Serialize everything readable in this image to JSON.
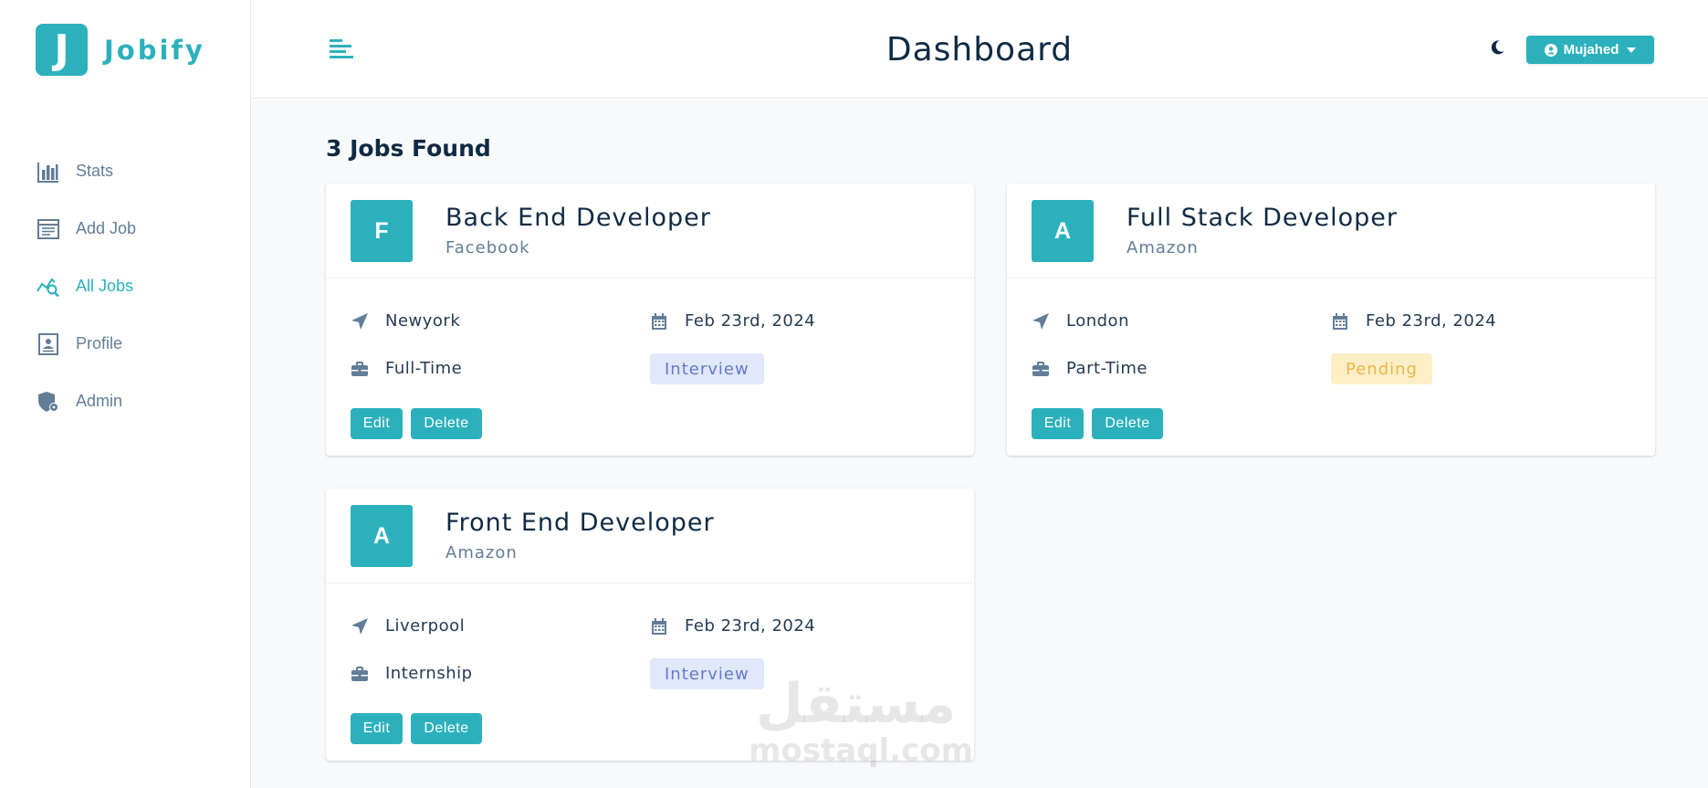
{
  "brand": {
    "logo_letter": "J",
    "name": "Jobify",
    "accent": "#2cb1bc"
  },
  "sidebar": {
    "items": [
      {
        "label": "Stats",
        "icon": "stats-chart-icon",
        "active": false
      },
      {
        "label": "Add Job",
        "icon": "add-job-form-icon",
        "active": false
      },
      {
        "label": "All Jobs",
        "icon": "all-jobs-search-icon",
        "active": true
      },
      {
        "label": "Profile",
        "icon": "profile-card-icon",
        "active": false
      },
      {
        "label": "Admin",
        "icon": "admin-shield-icon",
        "active": false
      }
    ]
  },
  "header": {
    "title": "Dashboard",
    "user_label": "Mujahed"
  },
  "main": {
    "jobs_found": "3 Jobs Found",
    "jobs": [
      {
        "avatar_letter": "F",
        "title": "Back End Developer",
        "company": "Facebook",
        "location": "Newyork",
        "date": "Feb 23rd, 2024",
        "type": "Full-Time",
        "status": "Interview",
        "status_kind": "interview",
        "edit_label": "Edit",
        "delete_label": "Delete"
      },
      {
        "avatar_letter": "A",
        "title": "Full Stack Developer",
        "company": "Amazon",
        "location": "London",
        "date": "Feb 23rd, 2024",
        "type": "Part-Time",
        "status": "Pending",
        "status_kind": "pending",
        "edit_label": "Edit",
        "delete_label": "Delete"
      },
      {
        "avatar_letter": "A",
        "title": "Front End Developer",
        "company": "Amazon",
        "location": "Liverpool",
        "date": "Feb 23rd, 2024",
        "type": "Internship",
        "status": "Interview",
        "status_kind": "interview",
        "edit_label": "Edit",
        "delete_label": "Delete"
      }
    ]
  },
  "watermark": {
    "arabic": "مستقل",
    "latin": "mostaql.com"
  },
  "colors": {
    "interview_bg": "#e0e8f9",
    "interview_text": "#647acb",
    "pending_bg": "#fcefc7",
    "pending_text": "#e9b949"
  }
}
